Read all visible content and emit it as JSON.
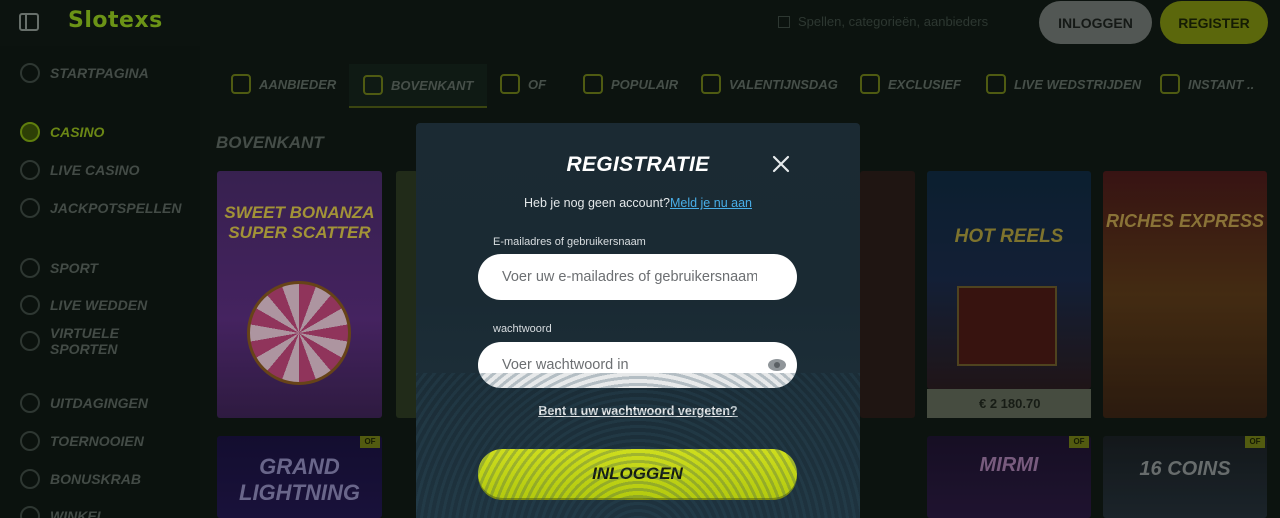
{
  "header": {
    "logo": "Slotexs",
    "search_text": "Spellen, categorieën, aanbieders",
    "login_label": "INLOGGEN",
    "register_label": "REGISTER"
  },
  "sidebar": {
    "items": [
      {
        "label": "STARTPAGINA",
        "icon": "home-icon"
      },
      {
        "label": "CASINO",
        "icon": "casino-icon",
        "active": true
      },
      {
        "label": "LIVE CASINO",
        "icon": "live-casino-icon"
      },
      {
        "label": "JACKPOTSPELLEN",
        "icon": "jackpot-icon"
      },
      {
        "label": "SPORT",
        "icon": "sport-icon"
      },
      {
        "label": "LIVE WEDDEN",
        "icon": "live-bet-icon"
      },
      {
        "label": "VIRTUELE SPORTEN",
        "icon": "virtual-sport-icon"
      },
      {
        "label": "UITDAGINGEN",
        "icon": "challenge-icon"
      },
      {
        "label": "TOERNOOIEN",
        "icon": "tournament-icon"
      },
      {
        "label": "BONUSKRAB",
        "icon": "scratch-icon"
      },
      {
        "label": "WINKEL",
        "icon": "shop-icon"
      }
    ]
  },
  "categories": [
    {
      "label": "AANBIEDER",
      "icon": "grid-icon"
    },
    {
      "label": "BOVENKANT",
      "icon": "top-icon",
      "active": true
    },
    {
      "label": "OF",
      "icon": "rocket-icon"
    },
    {
      "label": "POPULAIR",
      "icon": "flame-icon"
    },
    {
      "label": "VALENTIJNSDAG",
      "icon": "heart-icon"
    },
    {
      "label": "EXCLUSIEF",
      "icon": "diamond-icon"
    },
    {
      "label": "LIVE WEDSTRIJDEN",
      "icon": "live-icon"
    },
    {
      "label": "INSTANT ..",
      "icon": "instant-icon"
    }
  ],
  "section_title": "BOVENKANT",
  "games": {
    "tile1": "SWEET BONANZA SUPER SCATTER",
    "tile2": "GRAND LIGHTNING",
    "tile3": "HOT REELS",
    "tile4": "RICHES EXPRESS",
    "tile5": "MIRMI",
    "tile6": "16 COINS",
    "badge": "OF",
    "jackpot_value": "€ 2 180.70"
  },
  "modal": {
    "title": "REGISTRATIE",
    "prompt": "Heb je nog geen account?",
    "prompt_link": "Meld je nu aan",
    "email_label": "E-mailadres of gebruikersnaam",
    "email_placeholder": "Voer uw e-mailadres of gebruikersnaam in",
    "password_label": "wachtwoord",
    "password_placeholder": "Voer wachtwoord in",
    "forgot_link": "Bent u uw wachtwoord vergeten?",
    "submit_label": "INLOGGEN"
  },
  "colors": {
    "accent": "#d4ea12",
    "link": "#48aee8",
    "modal_bg": "#1b2a33"
  }
}
